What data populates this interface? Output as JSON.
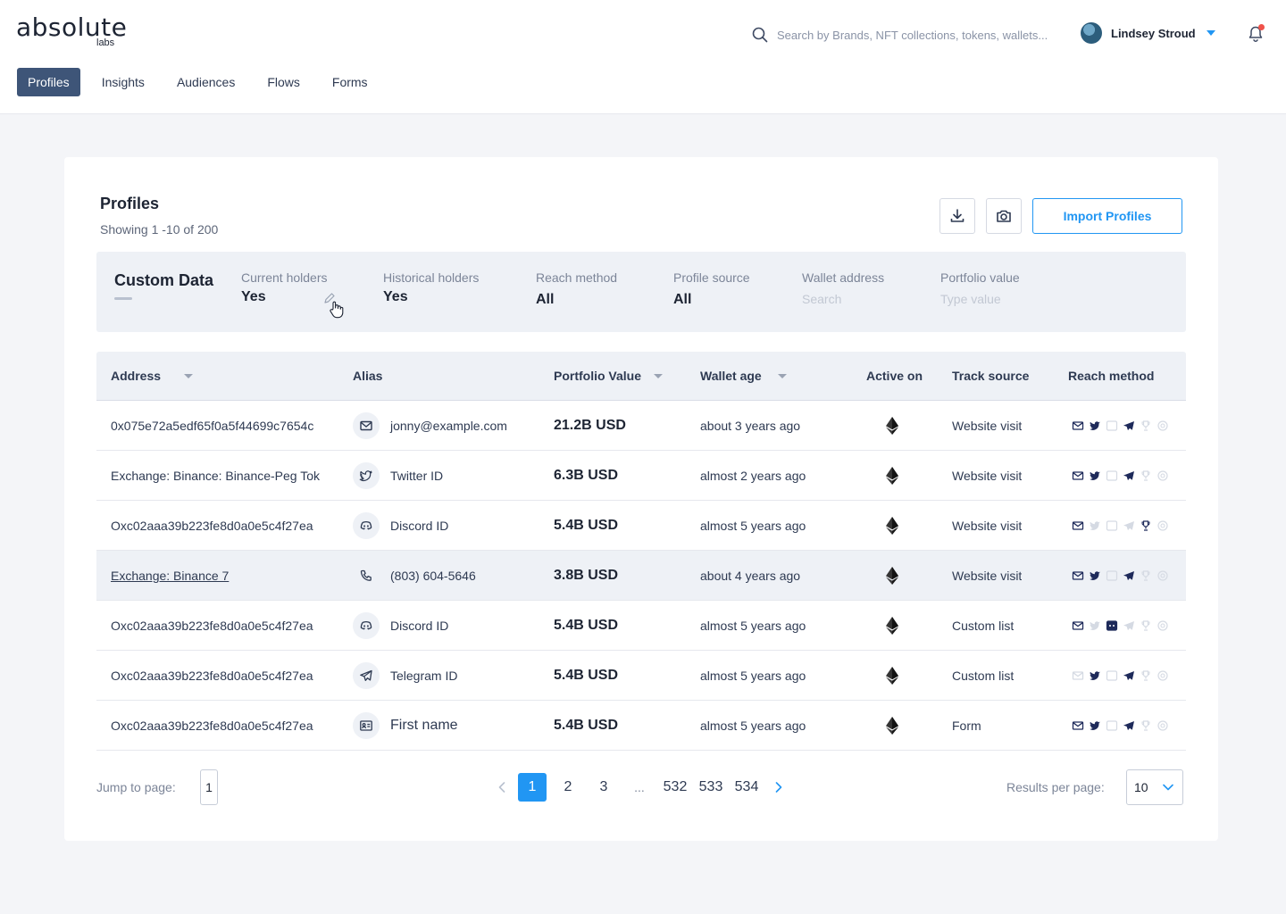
{
  "brand": {
    "name": "absolute",
    "sub": "labs"
  },
  "search": {
    "placeholder": "Search by Brands, NFT collections, tokens, wallets..."
  },
  "user": {
    "name": "Lindsey Stroud"
  },
  "nav": {
    "items": [
      {
        "label": "Profiles",
        "active": true
      },
      {
        "label": "Insights"
      },
      {
        "label": "Audiences"
      },
      {
        "label": "Flows"
      },
      {
        "label": "Forms"
      }
    ]
  },
  "header": {
    "title": "Profiles",
    "subtitle": "Showing 1 -10 of 200",
    "import_label": "Import Profiles"
  },
  "filters": {
    "title": "Custom Data",
    "current_holders": {
      "label": "Current holders",
      "value": "Yes"
    },
    "historical_holders": {
      "label": "Historical holders",
      "value": "Yes"
    },
    "reach_method": {
      "label": "Reach method",
      "value": "All"
    },
    "profile_source": {
      "label": "Profile source",
      "value": "All"
    },
    "wallet_address": {
      "label": "Wallet address",
      "placeholder": "Search"
    },
    "portfolio_value": {
      "label": "Portfolio value",
      "placeholder": "Type value"
    }
  },
  "table": {
    "columns": {
      "address": "Address",
      "alias": "Alias",
      "portfolio": "Portfolio Value",
      "wallet_age": "Wallet age",
      "active_on": "Active on",
      "track_source": "Track source",
      "reach_method": "Reach method"
    },
    "rows": [
      {
        "address": "0x075e72a5edf65f0a5f44699c7654c",
        "alias_icon": "mail-icon",
        "alias": "jonny@example.com",
        "portfolio": "21.2B USD",
        "age": "about 3 years ago",
        "track": "Website visit",
        "reach": [
          1,
          1,
          0,
          1,
          0,
          0
        ]
      },
      {
        "address": "Exchange: Binance: Binance-Peg Tok",
        "alias_icon": "twitter-icon",
        "alias": "Twitter ID",
        "portfolio": "6.3B USD",
        "age": "almost 2 years ago",
        "track": "Website visit",
        "reach": [
          1,
          1,
          0,
          1,
          0,
          0
        ]
      },
      {
        "address": "Oxc02aaa39b223fe8d0a0e5c4f27ea",
        "alias_icon": "discord-icon",
        "alias": "Discord ID",
        "portfolio": "5.4B USD",
        "age": "almost 5 years ago",
        "track": "Website visit",
        "reach": [
          1,
          0,
          0,
          0,
          1,
          0
        ]
      },
      {
        "address": "Exchange: Binance 7",
        "alias_icon": "phone-icon",
        "alias": "(803) 604-5646",
        "portfolio": "3.8B USD",
        "age": "about 4 years ago",
        "track": "Website visit",
        "reach": [
          1,
          1,
          0,
          1,
          0,
          0
        ],
        "highlight": true,
        "link": true
      },
      {
        "address": "Oxc02aaa39b223fe8d0a0e5c4f27ea",
        "alias_icon": "discord-icon",
        "alias": "Discord ID",
        "portfolio": "5.4B USD",
        "age": "almost 5 years ago",
        "track": "Custom list",
        "reach": [
          1,
          0,
          1,
          0,
          0,
          0
        ]
      },
      {
        "address": "Oxc02aaa39b223fe8d0a0e5c4f27ea",
        "alias_icon": "telegram-icon",
        "alias": "Telegram ID",
        "portfolio": "5.4B USD",
        "age": "almost 5 years ago",
        "track": "Custom list",
        "reach": [
          0,
          1,
          0,
          1,
          0,
          0
        ]
      },
      {
        "address": "Oxc02aaa39b223fe8d0a0e5c4f27ea",
        "alias_icon": "id-card-icon",
        "alias": "First name",
        "portfolio": "5.4B USD",
        "age": "almost 5 years ago",
        "track": "Form",
        "reach": [
          1,
          1,
          0,
          1,
          0,
          0
        ]
      }
    ]
  },
  "pagination": {
    "jump_label": "Jump to page:",
    "jump_value": "1",
    "pages": [
      "1",
      "2",
      "3",
      "...",
      "532",
      "533",
      "534"
    ],
    "current": "1",
    "rpp_label": "Results per page:",
    "rpp_value": "10"
  },
  "colors": {
    "accent": "#2196f3",
    "nav_active": "#3e5578",
    "icon_dark": "#1e2a5a",
    "icon_faded": "#d5dae3"
  }
}
